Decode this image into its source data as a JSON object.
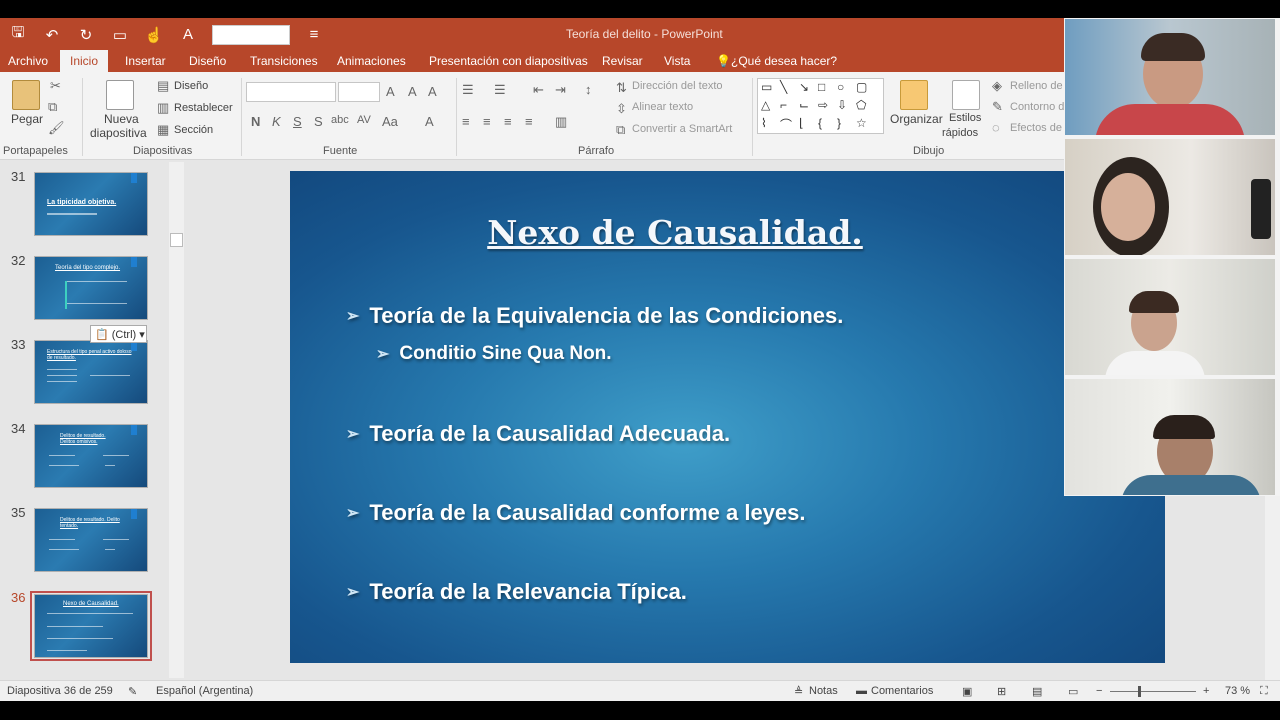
{
  "window": {
    "title": "Teoría del delito - PowerPoint"
  },
  "menu": {
    "tabs": [
      "Archivo",
      "Inicio",
      "Insertar",
      "Diseño",
      "Transiciones",
      "Animaciones",
      "Presentación con diapositivas",
      "Revisar",
      "Vista"
    ],
    "search": "¿Qué desea hacer?"
  },
  "ribbon": {
    "portapapeles": {
      "paste": "Pegar",
      "label": "Portapapeles"
    },
    "diapositivas": {
      "new_slide": "Nueva",
      "new_slide_2": "diapositiva",
      "layout": "Diseño",
      "reset": "Restablecer",
      "section": "Sección",
      "label": "Diapositivas"
    },
    "fuente": {
      "label": "Fuente",
      "bold": "N",
      "italic": "K",
      "underline": "S",
      "shadow": "S",
      "strike": "abc",
      "spacing": "AV",
      "case": "Aa",
      "color": "A"
    },
    "parrafo": {
      "label": "Párrafo",
      "text_direction": "Dirección del texto",
      "align_text": "Alinear texto",
      "smartart": "Convertir a SmartArt"
    },
    "dibujo": {
      "label": "Dibujo",
      "arrange": "Organizar",
      "styles": "Estilos",
      "styles_2": "rápidos",
      "fill": "Relleno de",
      "outline": "Contorno d",
      "effects": "Efectos de"
    }
  },
  "thumbnails": [
    {
      "num": "31",
      "title": "La tipicidad objetiva."
    },
    {
      "num": "32",
      "title": "Teoría del tipo complejo."
    },
    {
      "num": "33",
      "title": "Estructura del tipo penal activo doloso de resultado."
    },
    {
      "num": "34",
      "title": "Delitos de resultado. Delitos omisivos."
    },
    {
      "num": "35",
      "title": "Delitos de resultado. Delito tentado."
    },
    {
      "num": "36",
      "title": "Nexo de Causalidad."
    }
  ],
  "paste_tag": "(Ctrl)",
  "slide": {
    "title": "Nexo de Causalidad.",
    "bullets": [
      "Teoría de la Equivalencia de las Condiciones.",
      "Conditio Sine Qua Non.",
      "Teoría de la Causalidad Adecuada.",
      "Teoría de la Causalidad conforme a leyes.",
      "Teoría de la Relevancia Típica."
    ]
  },
  "status": {
    "slide_count": "Diapositiva 36 de 259",
    "language": "Español (Argentina)",
    "notes": "Notas",
    "comments": "Comentarios",
    "zoom": "73 %"
  },
  "colors": {
    "accent": "#b7472a",
    "slide_bg": "#2679ae",
    "selected_thumb": "#c0504d"
  }
}
